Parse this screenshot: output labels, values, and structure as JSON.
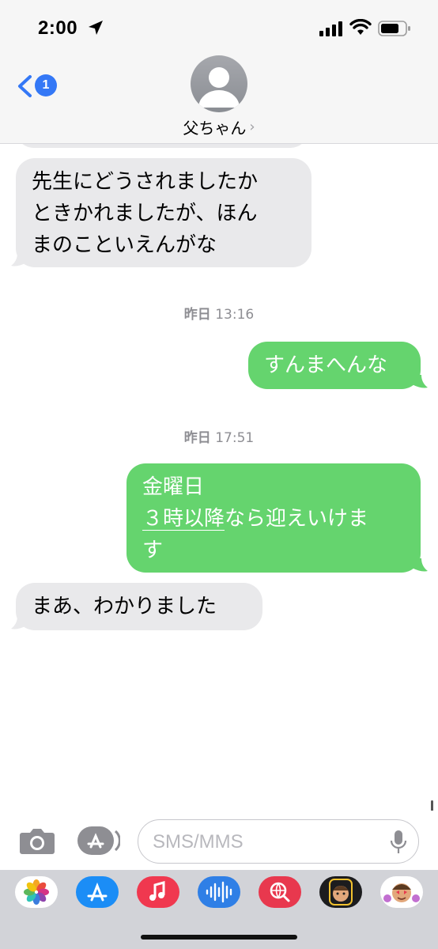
{
  "status_bar": {
    "time": "2:00"
  },
  "header": {
    "back_badge": "1",
    "contact_name": "父ちゃん",
    "chevron": "›"
  },
  "messages": {
    "incoming_1": [
      "先生にどうされましたか",
      "ときかれましたが、ほん",
      "まのこといえんがな"
    ],
    "timestamp_1": {
      "day": "昨日",
      "time": "13:16"
    },
    "outgoing_1": "すんまへんな",
    "timestamp_2": {
      "day": "昨日",
      "time": "17:51"
    },
    "outgoing_2": {
      "line1": "金曜日",
      "line2_link": "３時以降",
      "line2_rest": "なら迎えいけま",
      "line3": "す"
    },
    "incoming_2": "まあ、わかりました"
  },
  "composer": {
    "placeholder": "SMS/MMS"
  },
  "app_drawer": {
    "apps": [
      "photos-icon",
      "app-store-icon",
      "music-icon",
      "audio-message-icon",
      "search-images-icon",
      "memoji-icon",
      "animoji-icon"
    ]
  },
  "colors": {
    "outgoing_bubble": "#65d46e",
    "incoming_bubble": "#e9e9eb",
    "accent": "#3478f6"
  }
}
